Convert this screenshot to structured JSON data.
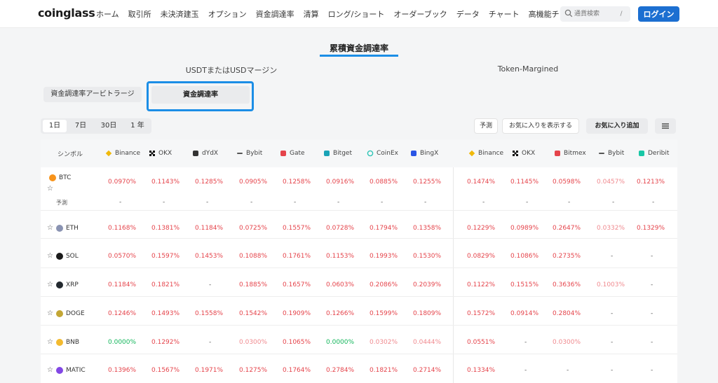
{
  "header": {
    "logo": "coinglass",
    "nav": [
      "ホーム",
      "取引所",
      "未決済建玉",
      "オプション",
      "資金調達率",
      "清算",
      "ロング/ショート",
      "オーダーブック",
      "データ",
      "チャート",
      "高機能チャート"
    ],
    "search_placeholder": "通貨検索",
    "search_shortcut": "/",
    "login": "ログイン"
  },
  "page_title": "累積資金調達率",
  "groups": {
    "usdt": "USDTまたはUSDマージン",
    "token": "Token-Margined"
  },
  "tabs": {
    "arbitrage": "資金調達率アービトラージ",
    "rate": "資金調達率"
  },
  "periods": [
    "1日",
    "7日",
    "30日",
    "1 年"
  ],
  "active_period": 0,
  "toolbar": {
    "forecast": "予測",
    "show_favorites": "お気に入りを表示する",
    "add_favorite": "お気に入り追加"
  },
  "table": {
    "symbol_header": "シンボル",
    "forecast_label": "予測",
    "usdt_exchanges": [
      "Binance",
      "OKX",
      "dYdX",
      "Bybit",
      "Gate",
      "Bitget",
      "CoinEx",
      "BingX"
    ],
    "token_exchanges": [
      "Binance",
      "OKX",
      "Bitmex",
      "Bybit",
      "Deribit"
    ],
    "rows": [
      {
        "symbol": "BTC",
        "usdt": [
          "0.0970%",
          "0.1143%",
          "0.1285%",
          "0.0905%",
          "0.1258%",
          "0.0916%",
          "0.0885%",
          "0.1255%"
        ],
        "token": [
          "0.1474%",
          "0.1145%",
          "0.0598%",
          "0.0457%",
          "0.1213%"
        ]
      },
      {
        "symbol": "ETH",
        "usdt": [
          "0.1168%",
          "0.1381%",
          "0.1184%",
          "0.0725%",
          "0.1557%",
          "0.0728%",
          "0.1794%",
          "0.1358%"
        ],
        "token": [
          "0.1229%",
          "0.0989%",
          "0.2647%",
          "0.0332%",
          "0.1329%"
        ]
      },
      {
        "symbol": "SOL",
        "usdt": [
          "0.0570%",
          "0.1597%",
          "0.1453%",
          "0.1088%",
          "0.1761%",
          "0.1153%",
          "0.1993%",
          "0.1530%"
        ],
        "token": [
          "0.0829%",
          "0.1086%",
          "0.2735%",
          "-",
          "-"
        ]
      },
      {
        "symbol": "XRP",
        "usdt": [
          "0.1184%",
          "0.1821%",
          "-",
          "0.1885%",
          "0.1657%",
          "0.0603%",
          "0.2086%",
          "0.2039%"
        ],
        "token": [
          "0.1122%",
          "0.1515%",
          "0.3636%",
          "0.1003%",
          "-"
        ]
      },
      {
        "symbol": "DOGE",
        "usdt": [
          "0.1246%",
          "0.1493%",
          "0.1558%",
          "0.1542%",
          "0.1909%",
          "0.1266%",
          "0.1599%",
          "0.1809%"
        ],
        "token": [
          "0.1572%",
          "0.0914%",
          "0.2804%",
          "-",
          "-"
        ]
      },
      {
        "symbol": "BNB",
        "usdt": [
          "0.0000%",
          "0.1292%",
          "-",
          "0.0300%",
          "0.1065%",
          "0.0000%",
          "0.0302%",
          "0.0444%"
        ],
        "token": [
          "0.0551%",
          "-",
          "0.0300%",
          "-",
          "-"
        ]
      },
      {
        "symbol": "MATIC",
        "usdt": [
          "0.1396%",
          "0.1567%",
          "0.1971%",
          "0.1275%",
          "0.1764%",
          "0.2784%",
          "0.1821%",
          "0.2714%"
        ],
        "token": [
          "0.1334%",
          "-",
          "-",
          "-",
          "-"
        ]
      }
    ]
  },
  "colors": {
    "accent": "#1c8ee6",
    "login": "#1c6fd1",
    "negative": "#e5444b",
    "light_negative": "#f08a8f",
    "zero": "#13b65b"
  }
}
